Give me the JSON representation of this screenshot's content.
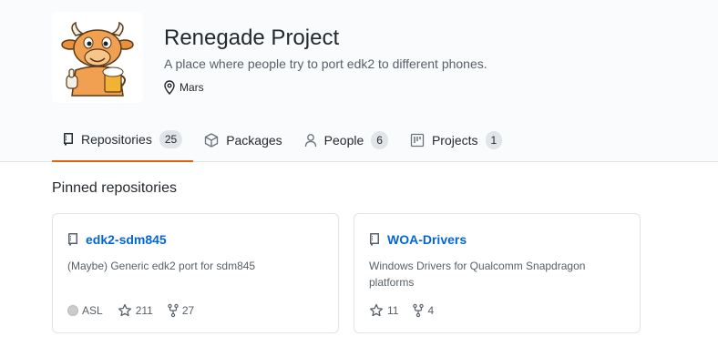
{
  "org": {
    "name": "Renegade Project",
    "description": "A place where people try to port edk2 to different phones.",
    "location": "Mars",
    "avatar_icon": "cow-mascot-avatar"
  },
  "tabs": [
    {
      "label": "Repositories",
      "count": "25",
      "icon": "repo-icon",
      "selected": true
    },
    {
      "label": "Packages",
      "count": "",
      "icon": "package-icon",
      "selected": false
    },
    {
      "label": "People",
      "count": "6",
      "icon": "person-icon",
      "selected": false
    },
    {
      "label": "Projects",
      "count": "1",
      "icon": "project-icon",
      "selected": false
    }
  ],
  "pinned": {
    "title": "Pinned repositories",
    "repos": [
      {
        "name": "edk2-sdm845",
        "description": "(Maybe) Generic edk2 port for sdm845",
        "language": "ASL",
        "language_color": "#cccccc",
        "stars": "211",
        "forks": "27"
      },
      {
        "name": "WOA-Drivers",
        "description": "Windows Drivers for Qualcomm Snapdragon platforms",
        "stars": "11",
        "forks": "4"
      }
    ]
  },
  "colors": {
    "accent_tab": "#e36209",
    "link": "#0366d6",
    "header_bg": "#fafbfc"
  }
}
